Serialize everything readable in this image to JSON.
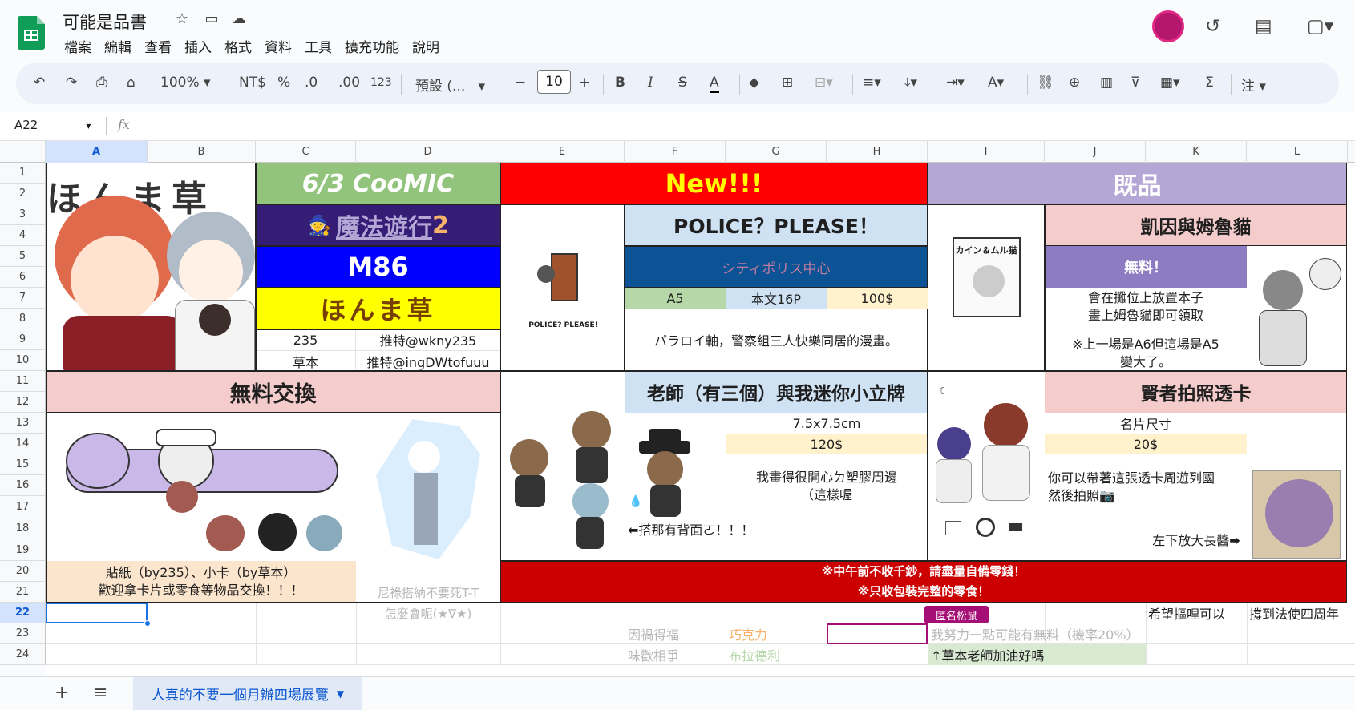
{
  "app": {
    "title": "可能是品書",
    "menu": [
      "檔案",
      "編輯",
      "查看",
      "插入",
      "格式",
      "資料",
      "工具",
      "擴充功能",
      "說明"
    ]
  },
  "toolbar": {
    "zoom": "100%",
    "currency": "NT$",
    "percent": "%",
    "dec_minus": ".0",
    "dec_plus": ".00",
    "num_format": "123",
    "font": "預設 (...",
    "font_size": "10",
    "bold": "B",
    "italic": "I",
    "text_color": "A"
  },
  "formula": {
    "cell_ref": "A22",
    "fx": "fx"
  },
  "columns": [
    "A",
    "B",
    "C",
    "D",
    "E",
    "F",
    "G",
    "H",
    "I",
    "J",
    "K",
    "L"
  ],
  "rows": [
    "1",
    "2",
    "3",
    "4",
    "5",
    "6",
    "7",
    "8",
    "9",
    "10",
    "11",
    "12",
    "13",
    "14",
    "15",
    "16",
    "17",
    "18",
    "19",
    "20",
    "21",
    "22",
    "23",
    "24"
  ],
  "sheet": {
    "coomic": "6/3 CooMIC",
    "magic": "魔法遊行",
    "magic_num": "2",
    "m86": "M86",
    "honma": "ほんま草",
    "c9": "235",
    "d9": "推特@wkny235",
    "c10": "草本",
    "d10": "推特@ingDWtofuuu",
    "new": "New!!!",
    "police_title": "POLICE？PLEASE！",
    "police_circle": "シティポリス中心",
    "f7": "A5",
    "g7": "本文16P",
    "h7": "100$",
    "police_desc": "パラロイ軸，警察組三人快樂同居的漫畫。",
    "police_img_label": "POLICE? PLEASE!",
    "kisei": "既品",
    "kain": "凱因與姆魯貓",
    "free": "無料！",
    "kain_desc1": "會在攤位上放置本子",
    "kain_desc2": "畫上姆魯貓即可領取",
    "kain_desc3": "※上一場是A6但這場是A5",
    "kain_desc4": "變大了。",
    "book_cover_title": "カイン＆ムル猫",
    "exchange": "無料交換",
    "ex_desc1": "貼紙（by235）、小卡（by草本）",
    "ex_desc2": "歡迎拿卡片或零食等物品交換！！！",
    "d21": "尼祿搭納不要死T-T",
    "d22": "怎麼會呢(★∇★)",
    "teacher": "老師（有三個）與我迷你小立牌",
    "g13": "7.5x7.5cm",
    "g14": "120$",
    "teacher_desc1": "我畫得很開心ㄉ塑膠周邊",
    "teacher_desc2": "（這樣喔",
    "teacher_note": "⬅搭那有背面ㄛ！！！",
    "sage": "賢者拍照透卡",
    "j13": "名片尺寸",
    "j14": "20$",
    "sage_desc1": "你可以帶著這張透卡周遊列國",
    "sage_desc2": "然後拍照📷",
    "sage_note": "左下放大長醬➡",
    "warn1": "※中午前不收千鈔，請盡量自備零錢！",
    "warn2": "※只收包裝完整的零食！",
    "comment_tag": "匿名松鼠",
    "k22": "希望摳哩可以",
    "l22": "撐到法使四周年",
    "f23": "因禍得福",
    "g23": "巧克力",
    "i23": "我努力一點可能有無料（機率20%）",
    "f24": "味歡相爭",
    "g24": "布拉德利",
    "i24": "↑草本老師加油好嗎"
  },
  "bottom": {
    "tab": "人真的不要一個月辦四場展覽"
  },
  "colors": {
    "green": "#93c47d",
    "purple": "#b4a7d6",
    "blue": "#0000ff",
    "yellow": "#ffff00",
    "red": "#ff0000",
    "darkred": "#cc0000",
    "pink": "#f4cccc",
    "lightblue": "#cfe2f3",
    "navy": "#0b5394"
  }
}
